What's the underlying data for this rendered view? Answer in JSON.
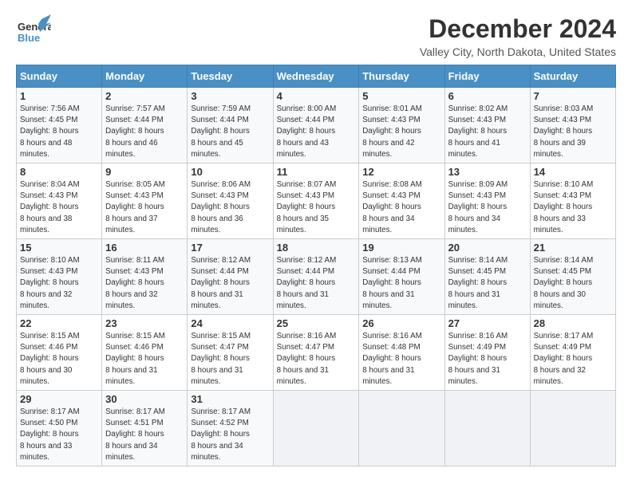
{
  "logo": {
    "general": "General",
    "blue": "Blue"
  },
  "title": "December 2024",
  "subtitle": "Valley City, North Dakota, United States",
  "headers": [
    "Sunday",
    "Monday",
    "Tuesday",
    "Wednesday",
    "Thursday",
    "Friday",
    "Saturday"
  ],
  "weeks": [
    [
      {
        "day": "1",
        "rise": "7:56 AM",
        "set": "4:45 PM",
        "hours": "8 hours and 48 minutes."
      },
      {
        "day": "2",
        "rise": "7:57 AM",
        "set": "4:44 PM",
        "hours": "8 hours and 46 minutes."
      },
      {
        "day": "3",
        "rise": "7:59 AM",
        "set": "4:44 PM",
        "hours": "8 hours and 45 minutes."
      },
      {
        "day": "4",
        "rise": "8:00 AM",
        "set": "4:44 PM",
        "hours": "8 hours and 43 minutes."
      },
      {
        "day": "5",
        "rise": "8:01 AM",
        "set": "4:43 PM",
        "hours": "8 hours and 42 minutes."
      },
      {
        "day": "6",
        "rise": "8:02 AM",
        "set": "4:43 PM",
        "hours": "8 hours and 41 minutes."
      },
      {
        "day": "7",
        "rise": "8:03 AM",
        "set": "4:43 PM",
        "hours": "8 hours and 39 minutes."
      }
    ],
    [
      {
        "day": "8",
        "rise": "8:04 AM",
        "set": "4:43 PM",
        "hours": "8 hours and 38 minutes."
      },
      {
        "day": "9",
        "rise": "8:05 AM",
        "set": "4:43 PM",
        "hours": "8 hours and 37 minutes."
      },
      {
        "day": "10",
        "rise": "8:06 AM",
        "set": "4:43 PM",
        "hours": "8 hours and 36 minutes."
      },
      {
        "day": "11",
        "rise": "8:07 AM",
        "set": "4:43 PM",
        "hours": "8 hours and 35 minutes."
      },
      {
        "day": "12",
        "rise": "8:08 AM",
        "set": "4:43 PM",
        "hours": "8 hours and 34 minutes."
      },
      {
        "day": "13",
        "rise": "8:09 AM",
        "set": "4:43 PM",
        "hours": "8 hours and 34 minutes."
      },
      {
        "day": "14",
        "rise": "8:10 AM",
        "set": "4:43 PM",
        "hours": "8 hours and 33 minutes."
      }
    ],
    [
      {
        "day": "15",
        "rise": "8:10 AM",
        "set": "4:43 PM",
        "hours": "8 hours and 32 minutes."
      },
      {
        "day": "16",
        "rise": "8:11 AM",
        "set": "4:43 PM",
        "hours": "8 hours and 32 minutes."
      },
      {
        "day": "17",
        "rise": "8:12 AM",
        "set": "4:44 PM",
        "hours": "8 hours and 31 minutes."
      },
      {
        "day": "18",
        "rise": "8:12 AM",
        "set": "4:44 PM",
        "hours": "8 hours and 31 minutes."
      },
      {
        "day": "19",
        "rise": "8:13 AM",
        "set": "4:44 PM",
        "hours": "8 hours and 31 minutes."
      },
      {
        "day": "20",
        "rise": "8:14 AM",
        "set": "4:45 PM",
        "hours": "8 hours and 31 minutes."
      },
      {
        "day": "21",
        "rise": "8:14 AM",
        "set": "4:45 PM",
        "hours": "8 hours and 30 minutes."
      }
    ],
    [
      {
        "day": "22",
        "rise": "8:15 AM",
        "set": "4:46 PM",
        "hours": "8 hours and 30 minutes."
      },
      {
        "day": "23",
        "rise": "8:15 AM",
        "set": "4:46 PM",
        "hours": "8 hours and 31 minutes."
      },
      {
        "day": "24",
        "rise": "8:15 AM",
        "set": "4:47 PM",
        "hours": "8 hours and 31 minutes."
      },
      {
        "day": "25",
        "rise": "8:16 AM",
        "set": "4:47 PM",
        "hours": "8 hours and 31 minutes."
      },
      {
        "day": "26",
        "rise": "8:16 AM",
        "set": "4:48 PM",
        "hours": "8 hours and 31 minutes."
      },
      {
        "day": "27",
        "rise": "8:16 AM",
        "set": "4:49 PM",
        "hours": "8 hours and 31 minutes."
      },
      {
        "day": "28",
        "rise": "8:17 AM",
        "set": "4:49 PM",
        "hours": "8 hours and 32 minutes."
      }
    ],
    [
      {
        "day": "29",
        "rise": "8:17 AM",
        "set": "4:50 PM",
        "hours": "8 hours and 33 minutes."
      },
      {
        "day": "30",
        "rise": "8:17 AM",
        "set": "4:51 PM",
        "hours": "8 hours and 34 minutes."
      },
      {
        "day": "31",
        "rise": "8:17 AM",
        "set": "4:52 PM",
        "hours": "8 hours and 34 minutes."
      },
      null,
      null,
      null,
      null
    ]
  ],
  "labels": {
    "sunrise": "Sunrise: ",
    "sunset": "Sunset: ",
    "daylight": "Daylight: "
  },
  "accent_color": "#4a90c4"
}
